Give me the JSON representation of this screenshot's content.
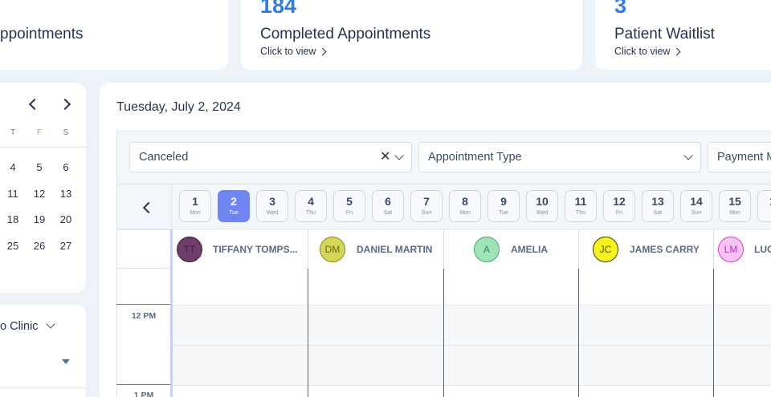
{
  "stats": [
    {
      "label": "ppointments",
      "number": "",
      "link": ""
    },
    {
      "label": "Completed Appointments",
      "number": "184",
      "link": "Click to view"
    },
    {
      "label": "Patient Waitlist",
      "number": "3",
      "link": "Click to view"
    }
  ],
  "mini_calendar": {
    "weekdays": [
      "T",
      "F",
      "S"
    ],
    "weeks": [
      [
        "4",
        "5",
        "6"
      ],
      [
        "11",
        "12",
        "13"
      ],
      [
        "18",
        "19",
        "20"
      ],
      [
        "25",
        "26",
        "27"
      ]
    ]
  },
  "clinic": {
    "label": "o Clinic"
  },
  "calendar": {
    "date_title": "Tuesday, July 2, 2024",
    "filters": {
      "status": "Canceled",
      "appointment_type": "Appointment Type",
      "payment": "Payment M"
    },
    "days": [
      {
        "n": "1",
        "w": "Mon"
      },
      {
        "n": "2",
        "w": "Tue"
      },
      {
        "n": "3",
        "w": "Wed"
      },
      {
        "n": "4",
        "w": "Thu"
      },
      {
        "n": "5",
        "w": "Fri"
      },
      {
        "n": "6",
        "w": "Sat"
      },
      {
        "n": "7",
        "w": "Sun"
      },
      {
        "n": "8",
        "w": "Mon"
      },
      {
        "n": "9",
        "w": "Tue"
      },
      {
        "n": "10",
        "w": "Wed"
      },
      {
        "n": "11",
        "w": "Thu"
      },
      {
        "n": "12",
        "w": "Fri"
      },
      {
        "n": "13",
        "w": "Sat"
      },
      {
        "n": "14",
        "w": "Sun"
      },
      {
        "n": "15",
        "w": "Mon"
      },
      {
        "n": "1",
        "w": ""
      }
    ],
    "selected_day": "2",
    "providers": [
      {
        "initials": "TT",
        "name": "TIFFANY TOMPS...",
        "bg": "#6e3d6a",
        "border": "#3d1e3a",
        "fg": "#3d1e3a"
      },
      {
        "initials": "DM",
        "name": "DANIEL MARTIN",
        "bg": "#d4d65a",
        "border": "#8a8c1e",
        "fg": "#6a6c10"
      },
      {
        "initials": "A",
        "name": "AMELIA",
        "bg": "#9fe3b7",
        "border": "#3fae6a",
        "fg": "#2f8f54"
      },
      {
        "initials": "JC",
        "name": "JAMES CARRY",
        "bg": "#f5f21d",
        "border": "#3d3d10",
        "fg": "#5a5a10"
      },
      {
        "initials": "LM",
        "name": "LUC",
        "bg": "#f7c4f4",
        "border": "#d23fcf",
        "fg": "#c02fbd"
      }
    ],
    "times": [
      "12 PM",
      "1 PM"
    ]
  }
}
